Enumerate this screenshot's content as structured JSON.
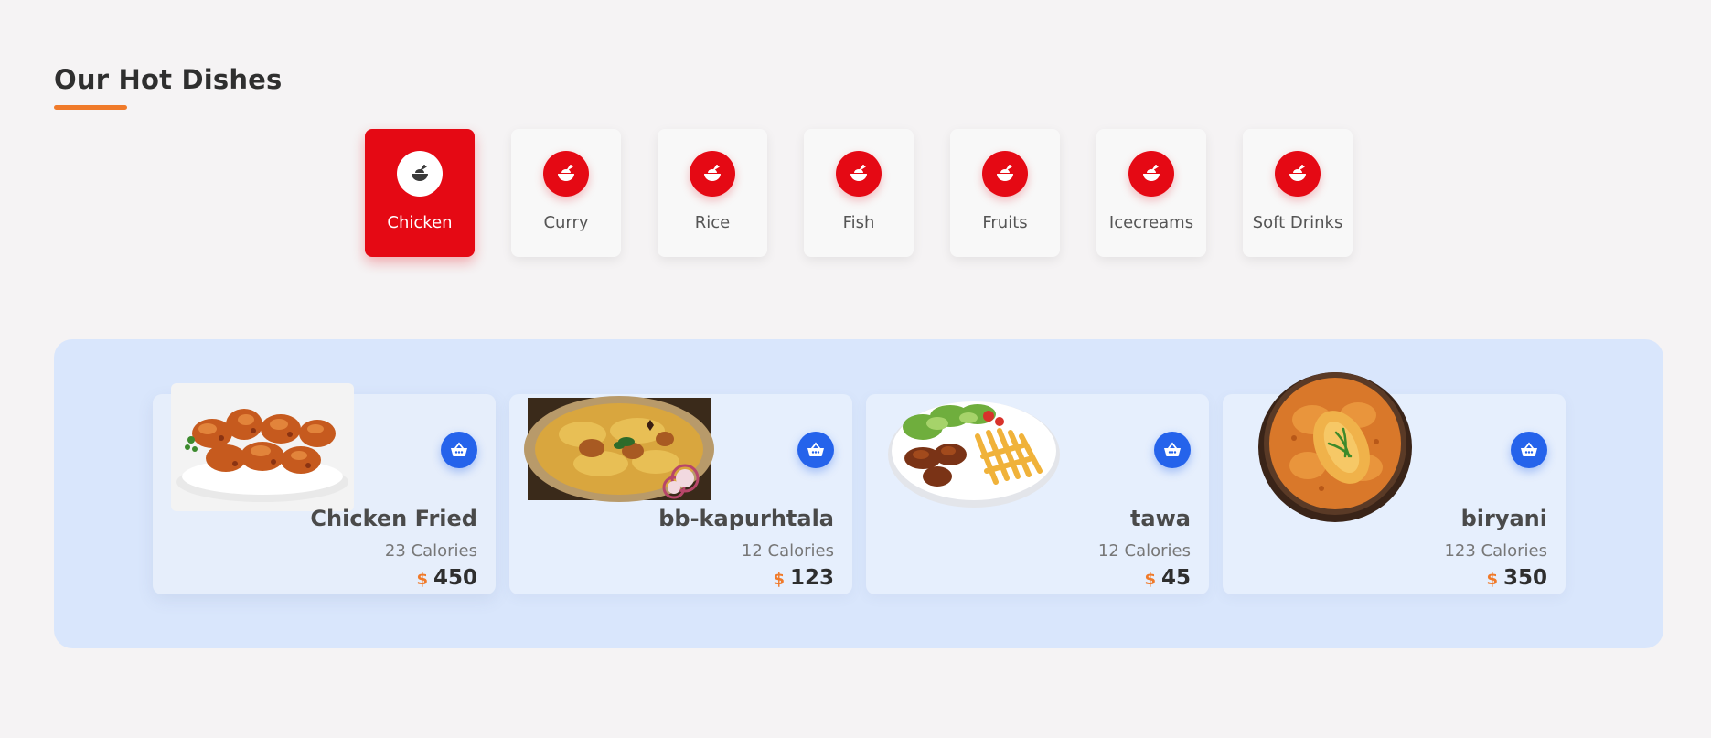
{
  "section": {
    "title": "Our Hot Dishes"
  },
  "categories": [
    {
      "label": "Chicken",
      "active": true,
      "icon": "food-icon"
    },
    {
      "label": "Curry",
      "active": false,
      "icon": "food-icon"
    },
    {
      "label": "Rice",
      "active": false,
      "icon": "food-icon"
    },
    {
      "label": "Fish",
      "active": false,
      "icon": "food-icon"
    },
    {
      "label": "Fruits",
      "active": false,
      "icon": "food-icon"
    },
    {
      "label": "Icecreams",
      "active": false,
      "icon": "food-icon"
    },
    {
      "label": "Soft Drinks",
      "active": false,
      "icon": "food-icon"
    }
  ],
  "dishes": [
    {
      "name": "Chicken Fried",
      "calories": "23 Calories",
      "currency": "$",
      "price": "450",
      "image": "fried-chicken-plate"
    },
    {
      "name": "bb-kapurhtala",
      "calories": "12 Calories",
      "currency": "$",
      "price": "123",
      "image": "biryani-platter"
    },
    {
      "name": "tawa",
      "calories": "12 Calories",
      "currency": "$",
      "price": "45",
      "image": "chicken-fries-plate"
    },
    {
      "name": "biryani",
      "calories": "123 Calories",
      "currency": "$",
      "price": "350",
      "image": "curry-bowl"
    }
  ],
  "colors": {
    "accent": "#e50914",
    "cart": "#2563eb",
    "underline": "#f07a2a",
    "panel": "#d9e6fc",
    "background": "#f5f3f4"
  }
}
